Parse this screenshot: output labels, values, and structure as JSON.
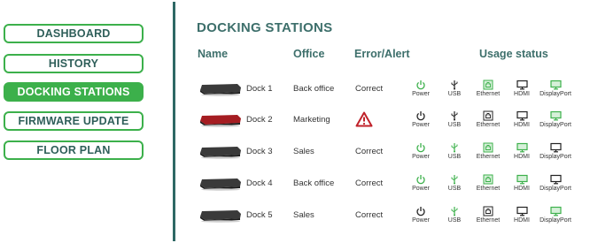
{
  "sidebar": {
    "items": [
      {
        "label": "DASHBOARD",
        "active": false
      },
      {
        "label": "HISTORY",
        "active": false
      },
      {
        "label": "DOCKING STATIONS",
        "active": true
      },
      {
        "label": "FIRMWARE UPDATE",
        "active": false
      },
      {
        "label": "FLOOR PLAN",
        "active": false
      }
    ]
  },
  "main": {
    "title": "DOCKING STATIONS",
    "columns": {
      "name": "Name",
      "office": "Office",
      "error": "Error/Alert",
      "usage": "Usage status"
    },
    "status_labels": {
      "power": "Power",
      "usb": "USB",
      "ethernet": "Ethernet",
      "hdmi": "HDMI",
      "displayport": "DisplayPort"
    },
    "rows": [
      {
        "name": "Dock 1",
        "office": "Back office",
        "error": "Correct",
        "alert": false,
        "status": {
          "power": true,
          "usb": false,
          "ethernet": true,
          "hdmi": false,
          "displayport": true
        }
      },
      {
        "name": "Dock 2",
        "office": "Marketing",
        "error": "",
        "alert": true,
        "status": {
          "power": false,
          "usb": false,
          "ethernet": false,
          "hdmi": false,
          "displayport": true
        }
      },
      {
        "name": "Dock 3",
        "office": "Sales",
        "error": "Correct",
        "alert": false,
        "status": {
          "power": true,
          "usb": true,
          "ethernet": true,
          "hdmi": true,
          "displayport": false
        }
      },
      {
        "name": "Dock 4",
        "office": "Back office",
        "error": "Correct",
        "alert": false,
        "status": {
          "power": true,
          "usb": true,
          "ethernet": true,
          "hdmi": true,
          "displayport": false
        }
      },
      {
        "name": "Dock 5",
        "office": "Sales",
        "error": "Correct",
        "alert": false,
        "status": {
          "power": false,
          "usb": true,
          "ethernet": false,
          "hdmi": false,
          "displayport": true
        }
      }
    ]
  },
  "colors": {
    "accent": "#3cb04b",
    "title": "#3d6f6b",
    "divider": "#2e6865",
    "active_icon": "#3cb04b",
    "inactive_icon": "#222222",
    "alert": "#c0222a",
    "dock_normal": "#3a3a3a",
    "dock_alert": "#a51d22"
  }
}
